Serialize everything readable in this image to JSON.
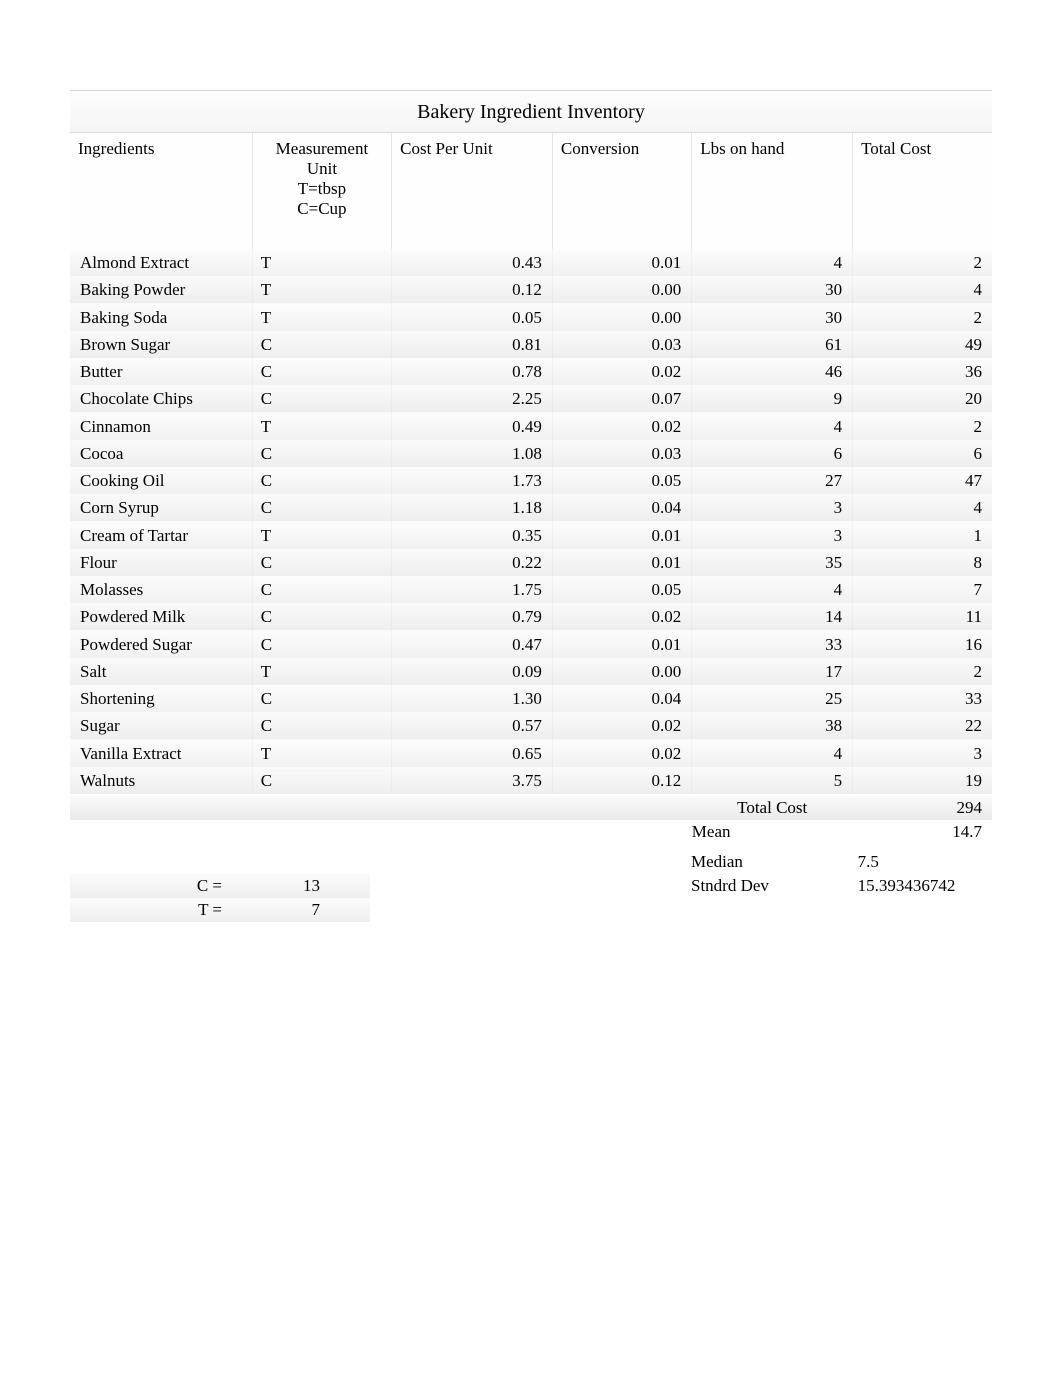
{
  "title": "Bakery Ingredient Inventory",
  "headers": {
    "ingredients": "Ingredients",
    "measurement_l1": "Measurement",
    "measurement_l2": "Unit",
    "measurement_l3": "T=tbsp",
    "measurement_l4": "C=Cup",
    "cost_per_unit": "Cost Per Unit",
    "conversion": "Conversion",
    "lbs_on_hand": "Lbs on hand",
    "total_cost": "Total Cost"
  },
  "rows": [
    {
      "ingredient": "Almond Extract",
      "unit": "T",
      "cpu": "0.43",
      "conv": "0.01",
      "lbs": "4",
      "total": "2"
    },
    {
      "ingredient": "Baking Powder",
      "unit": "T",
      "cpu": "0.12",
      "conv": "0.00",
      "lbs": "30",
      "total": "4"
    },
    {
      "ingredient": "Baking Soda",
      "unit": "T",
      "cpu": "0.05",
      "conv": "0.00",
      "lbs": "30",
      "total": "2"
    },
    {
      "ingredient": "Brown Sugar",
      "unit": "C",
      "cpu": "0.81",
      "conv": "0.03",
      "lbs": "61",
      "total": "49"
    },
    {
      "ingredient": "Butter",
      "unit": "C",
      "cpu": "0.78",
      "conv": "0.02",
      "lbs": "46",
      "total": "36"
    },
    {
      "ingredient": "Chocolate Chips",
      "unit": "C",
      "cpu": "2.25",
      "conv": "0.07",
      "lbs": "9",
      "total": "20"
    },
    {
      "ingredient": "Cinnamon",
      "unit": "T",
      "cpu": "0.49",
      "conv": "0.02",
      "lbs": "4",
      "total": "2"
    },
    {
      "ingredient": "Cocoa",
      "unit": "C",
      "cpu": "1.08",
      "conv": "0.03",
      "lbs": "6",
      "total": "6"
    },
    {
      "ingredient": "Cooking Oil",
      "unit": "C",
      "cpu": "1.73",
      "conv": "0.05",
      "lbs": "27",
      "total": "47"
    },
    {
      "ingredient": "Corn Syrup",
      "unit": "C",
      "cpu": "1.18",
      "conv": "0.04",
      "lbs": "3",
      "total": "4"
    },
    {
      "ingredient": "Cream of Tartar",
      "unit": "T",
      "cpu": "0.35",
      "conv": "0.01",
      "lbs": "3",
      "total": "1"
    },
    {
      "ingredient": "Flour",
      "unit": "C",
      "cpu": "0.22",
      "conv": "0.01",
      "lbs": "35",
      "total": "8"
    },
    {
      "ingredient": "Molasses",
      "unit": "C",
      "cpu": "1.75",
      "conv": "0.05",
      "lbs": "4",
      "total": "7"
    },
    {
      "ingredient": "Powdered Milk",
      "unit": "C",
      "cpu": "0.79",
      "conv": "0.02",
      "lbs": "14",
      "total": "11"
    },
    {
      "ingredient": "Powdered Sugar",
      "unit": "C",
      "cpu": "0.47",
      "conv": "0.01",
      "lbs": "33",
      "total": "16"
    },
    {
      "ingredient": "Salt",
      "unit": "T",
      "cpu": "0.09",
      "conv": "0.00",
      "lbs": "17",
      "total": "2"
    },
    {
      "ingredient": "Shortening",
      "unit": "C",
      "cpu": "1.30",
      "conv": "0.04",
      "lbs": "25",
      "total": "33"
    },
    {
      "ingredient": "Sugar",
      "unit": "C",
      "cpu": "0.57",
      "conv": "0.02",
      "lbs": "38",
      "total": "22"
    },
    {
      "ingredient": "Vanilla Extract",
      "unit": "T",
      "cpu": "0.65",
      "conv": "0.02",
      "lbs": "4",
      "total": "3"
    },
    {
      "ingredient": "Walnuts",
      "unit": "C",
      "cpu": "3.75",
      "conv": "0.12",
      "lbs": "5",
      "total": "19"
    }
  ],
  "summary": {
    "total_cost_label": "Total Cost",
    "total_cost_value": "294",
    "mean_label": "Mean",
    "mean_value": "14.7",
    "median_label": "Median",
    "median_value": "7.5",
    "stddev_label": "Stndrd Dev",
    "stddev_value": "15.393436742"
  },
  "legend": {
    "c_label": "C =",
    "c_value": "13",
    "t_label": "T =",
    "t_value": "7"
  },
  "chart_data": {
    "type": "table",
    "title": "Bakery Ingredient Inventory",
    "columns": [
      "Ingredients",
      "Measurement Unit",
      "Cost Per Unit",
      "Conversion",
      "Lbs on hand",
      "Total Cost"
    ],
    "rows": [
      [
        "Almond Extract",
        "T",
        0.43,
        0.01,
        4,
        2
      ],
      [
        "Baking Powder",
        "T",
        0.12,
        0.0,
        30,
        4
      ],
      [
        "Baking Soda",
        "T",
        0.05,
        0.0,
        30,
        2
      ],
      [
        "Brown Sugar",
        "C",
        0.81,
        0.03,
        61,
        49
      ],
      [
        "Butter",
        "C",
        0.78,
        0.02,
        46,
        36
      ],
      [
        "Chocolate Chips",
        "C",
        2.25,
        0.07,
        9,
        20
      ],
      [
        "Cinnamon",
        "T",
        0.49,
        0.02,
        4,
        2
      ],
      [
        "Cocoa",
        "C",
        1.08,
        0.03,
        6,
        6
      ],
      [
        "Cooking Oil",
        "C",
        1.73,
        0.05,
        27,
        47
      ],
      [
        "Corn Syrup",
        "C",
        1.18,
        0.04,
        3,
        4
      ],
      [
        "Cream of Tartar",
        "T",
        0.35,
        0.01,
        3,
        1
      ],
      [
        "Flour",
        "C",
        0.22,
        0.01,
        35,
        8
      ],
      [
        "Molasses",
        "C",
        1.75,
        0.05,
        4,
        7
      ],
      [
        "Powdered Milk",
        "C",
        0.79,
        0.02,
        14,
        11
      ],
      [
        "Powdered Sugar",
        "C",
        0.47,
        0.01,
        33,
        16
      ],
      [
        "Salt",
        "T",
        0.09,
        0.0,
        17,
        2
      ],
      [
        "Shortening",
        "C",
        1.3,
        0.04,
        25,
        33
      ],
      [
        "Sugar",
        "C",
        0.57,
        0.02,
        38,
        22
      ],
      [
        "Vanilla Extract",
        "T",
        0.65,
        0.02,
        4,
        3
      ],
      [
        "Walnuts",
        "C",
        3.75,
        0.12,
        5,
        19
      ]
    ],
    "aggregates": {
      "Total Cost": 294,
      "Mean": 14.7,
      "Median": 7.5,
      "Stndrd Dev": 15.393436742,
      "C count": 13,
      "T count": 7
    }
  }
}
